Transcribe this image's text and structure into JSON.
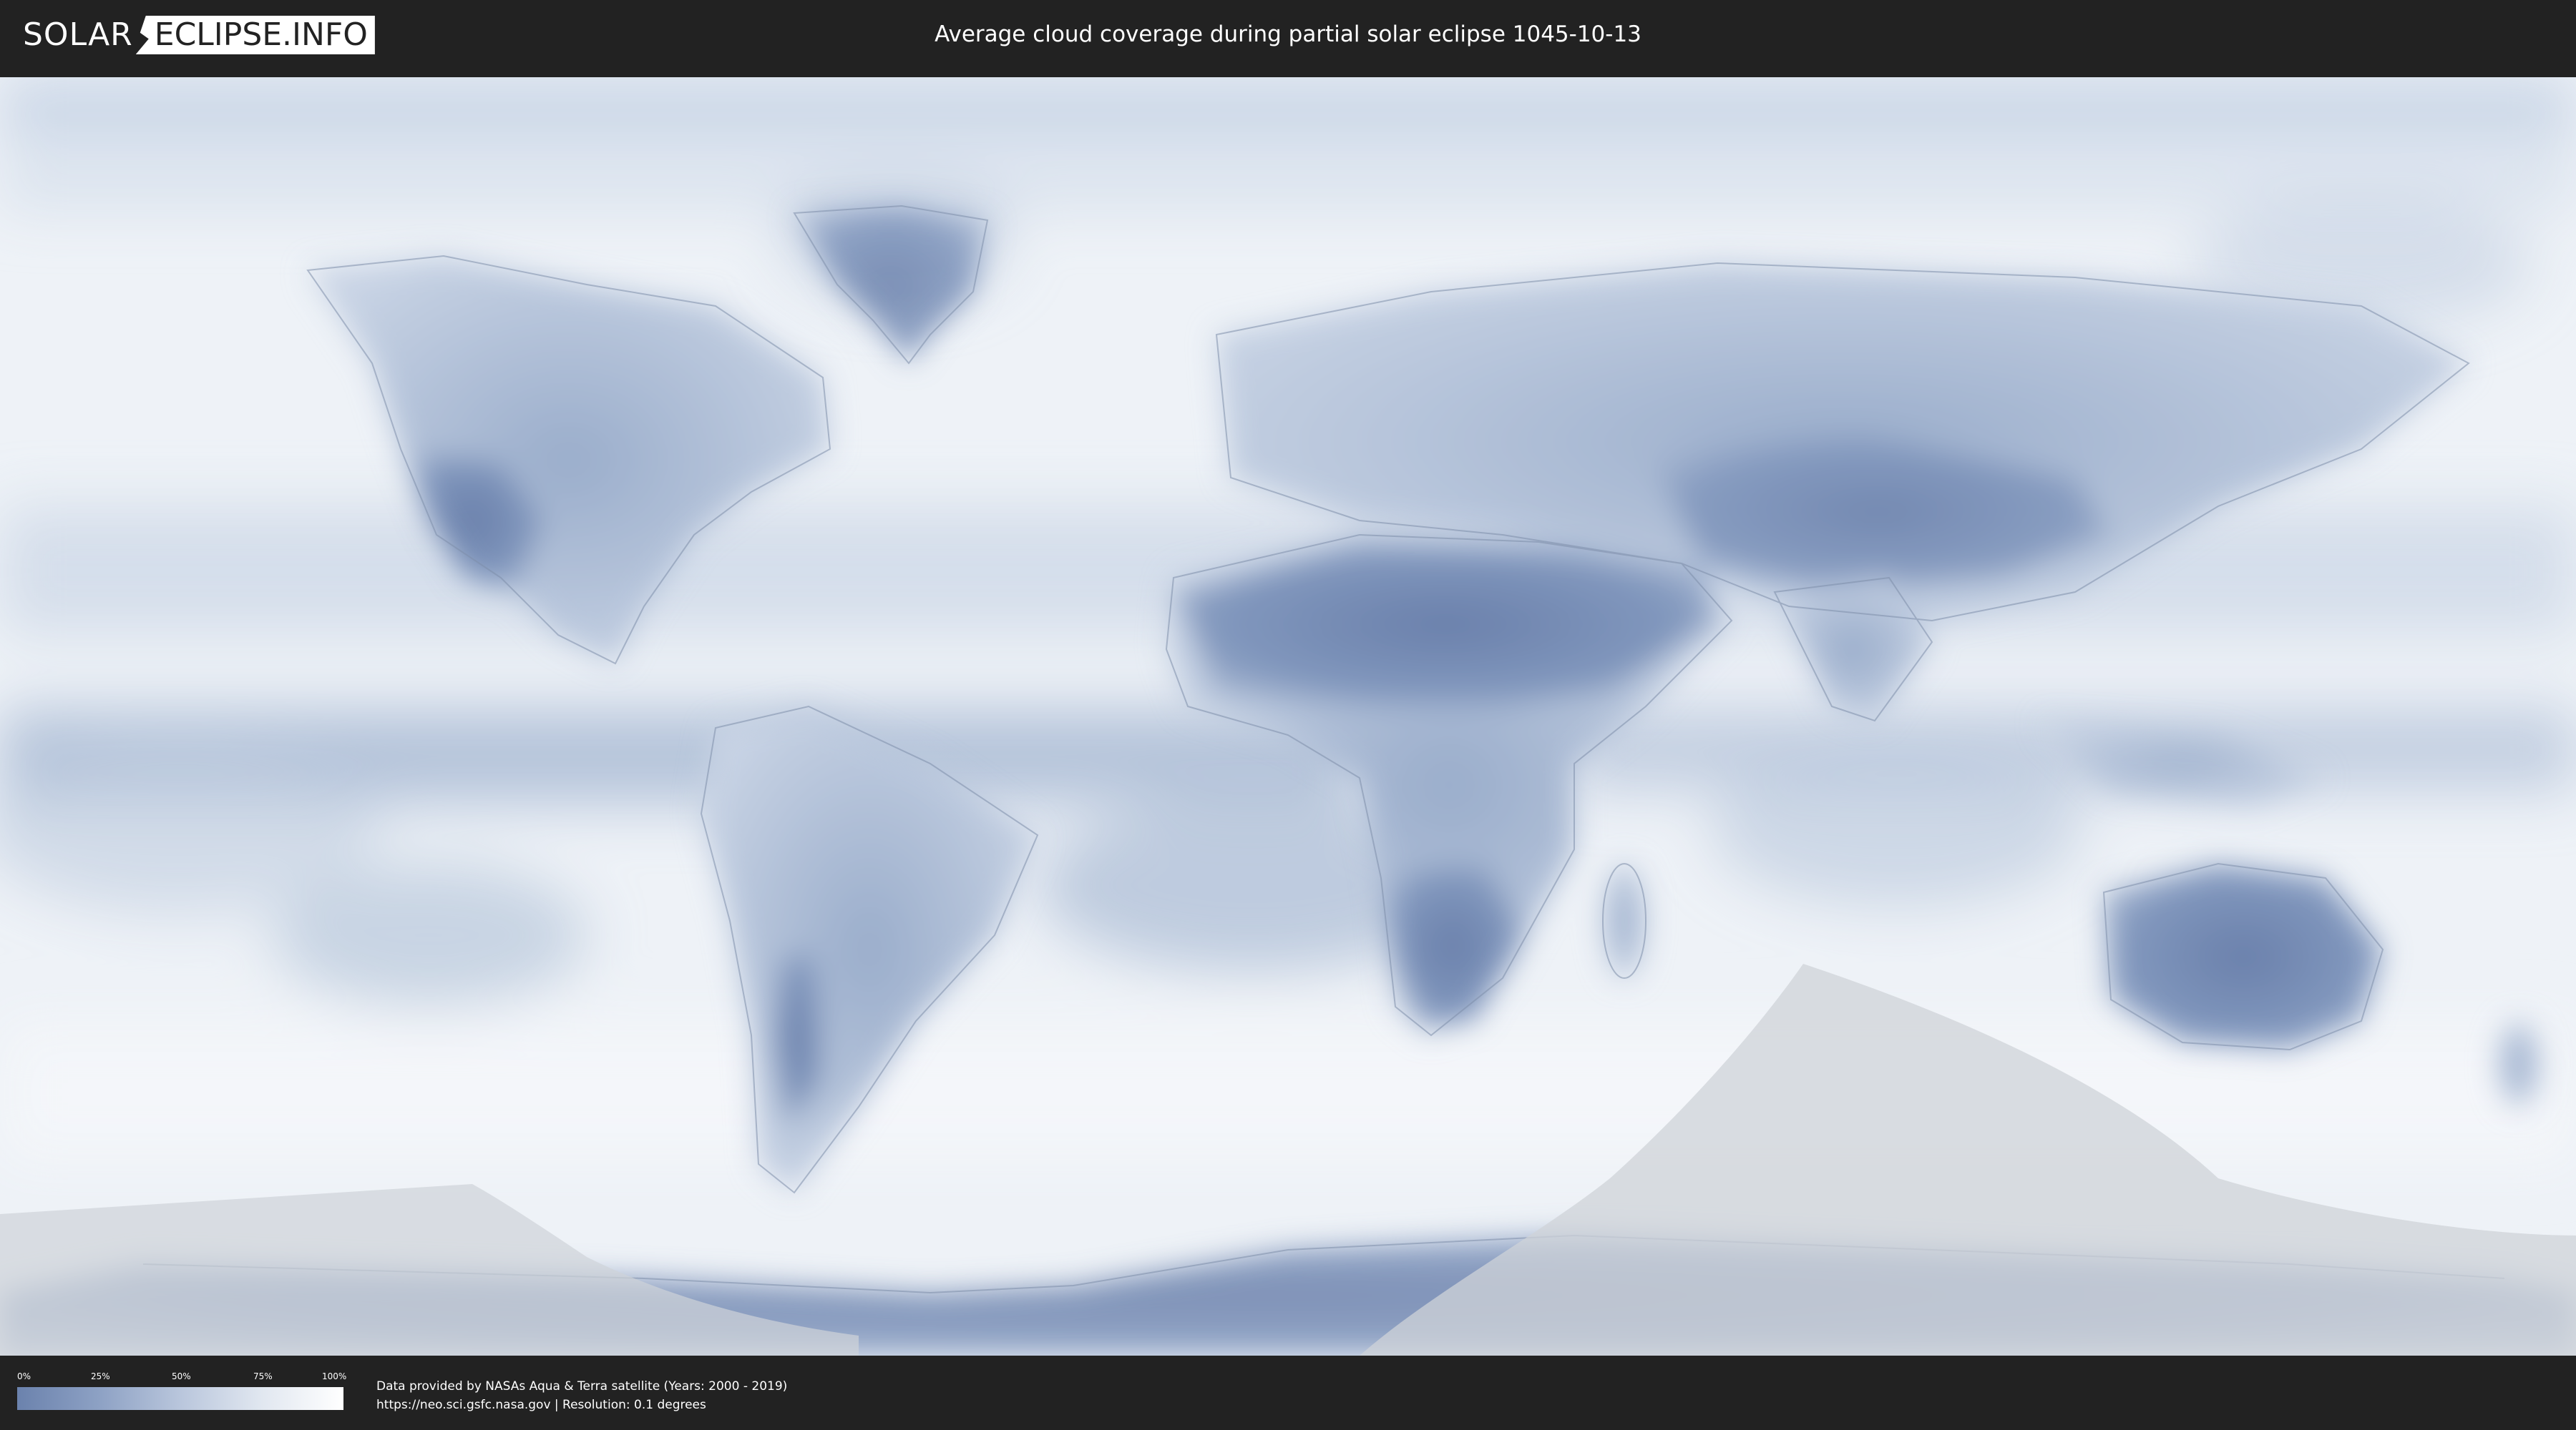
{
  "header": {
    "logo_part1": "SOLAR",
    "logo_part2": "ECLIPSE.INFO",
    "title": "Average cloud coverage during partial solar eclipse 1045-10-13"
  },
  "legend": {
    "ticks": [
      "0%",
      "25%",
      "50%",
      "75%",
      "100%"
    ],
    "colors": [
      "#6b82ad",
      "#8da1c4",
      "#b9c6dc",
      "#e1e7f0",
      "#ffffff"
    ]
  },
  "footer": {
    "credit_line1": "Data provided by NASAs Aqua & Terra satellite (Years: 2000 - 2019)",
    "credit_line2": "https://neo.sci.gsfc.nasa.gov | Resolution: 0.1 degrees"
  },
  "map": {
    "projection": "equirectangular",
    "eclipse_zone_color": "#cfd3d8",
    "low_cloud_color": "#6b82ad",
    "high_cloud_color": "#ffffff"
  }
}
